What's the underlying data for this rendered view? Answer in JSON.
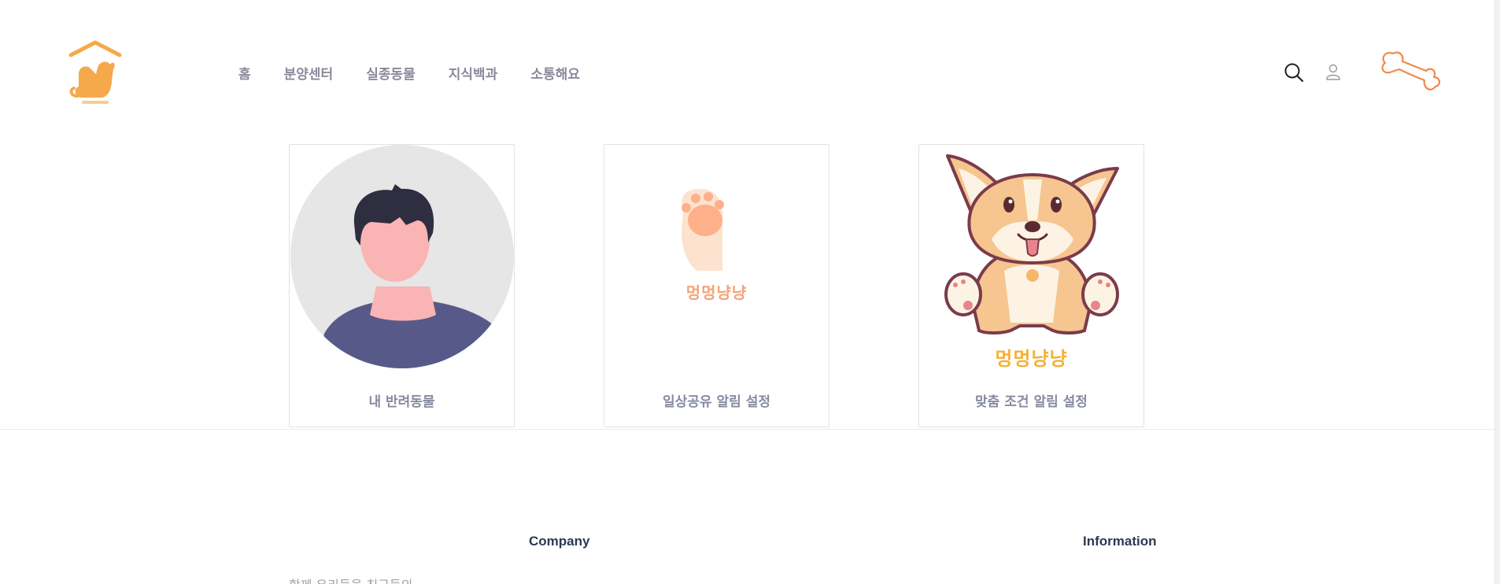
{
  "nav": {
    "items": [
      "홈",
      "분양센터",
      "실종동물",
      "지식백과",
      "소통해요"
    ]
  },
  "header": {
    "logo_icon": "dog-cat-house-logo",
    "search_icon": "search-icon",
    "user_icon": "user-icon",
    "bone_icon": "bone-icon"
  },
  "cards": [
    {
      "label": "내 반려동물",
      "art": "avatar-person"
    },
    {
      "label": "일상공유 알림 설정",
      "art": "paw-logo",
      "logo_text": "멍멍냥냥"
    },
    {
      "label": "맞춤 조건 알림 설정",
      "art": "corgi-logo",
      "logo_text": "멍멍냥냥"
    }
  ],
  "footer": {
    "company_heading": "Company",
    "information_heading": "Information",
    "company_text": "함께 우리들을 친구들의"
  },
  "colors": {
    "accent_orange": "#f5a94a",
    "bone_orange": "#f08a4b",
    "label_gray": "#868aa2",
    "avatar_bg": "#e6e6e6",
    "shirt": "#575a89",
    "skin": "#fbb4b4",
    "hair": "#2f2e41"
  }
}
